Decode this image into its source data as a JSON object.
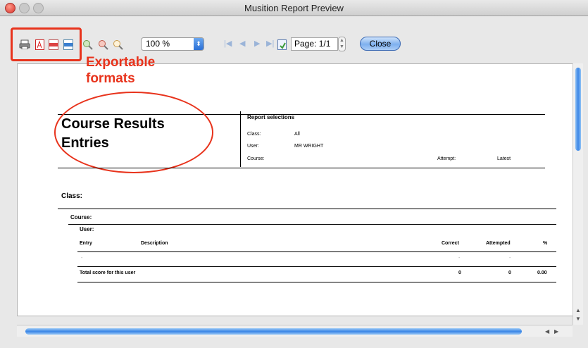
{
  "window": {
    "title": "Musition Report Preview"
  },
  "toolbar": {
    "zoom_value": "100 %",
    "page_label": "Page: 1/1",
    "close_label": "Close",
    "export_annotation_line1": "Exportable",
    "export_annotation_line2": "formats",
    "icons": [
      "print-icon",
      "pdf-icon",
      "svg-icon",
      "csv-icon",
      "zoom-in-icon",
      "zoom-out-icon",
      "zoom-fit-icon",
      "first-page-icon",
      "prev-page-icon",
      "next-page-icon",
      "last-page-icon",
      "export-page-icon"
    ]
  },
  "report": {
    "title_line1": "Course Results",
    "title_line2": "Entries",
    "selections_heading": "Report selections",
    "class_label": "Class:",
    "class_value": "All",
    "user_label": "User:",
    "user_value": "MR WRIGHT",
    "course_label": "Course:",
    "attempt_label": "Attempt:",
    "attempt_value": "Latest",
    "group_class": "Class:",
    "group_course": "Course:",
    "group_user": "User:",
    "columns": {
      "entry": "Entry",
      "description": "Description",
      "correct": "Correct",
      "attempted": "Attempted",
      "percent": "%"
    },
    "row": {
      "entry": "-",
      "correct": "-",
      "attempted": "-"
    },
    "total": {
      "label": "Total score for this user",
      "correct": "0",
      "attempted": "0",
      "percent": "0.00"
    }
  }
}
